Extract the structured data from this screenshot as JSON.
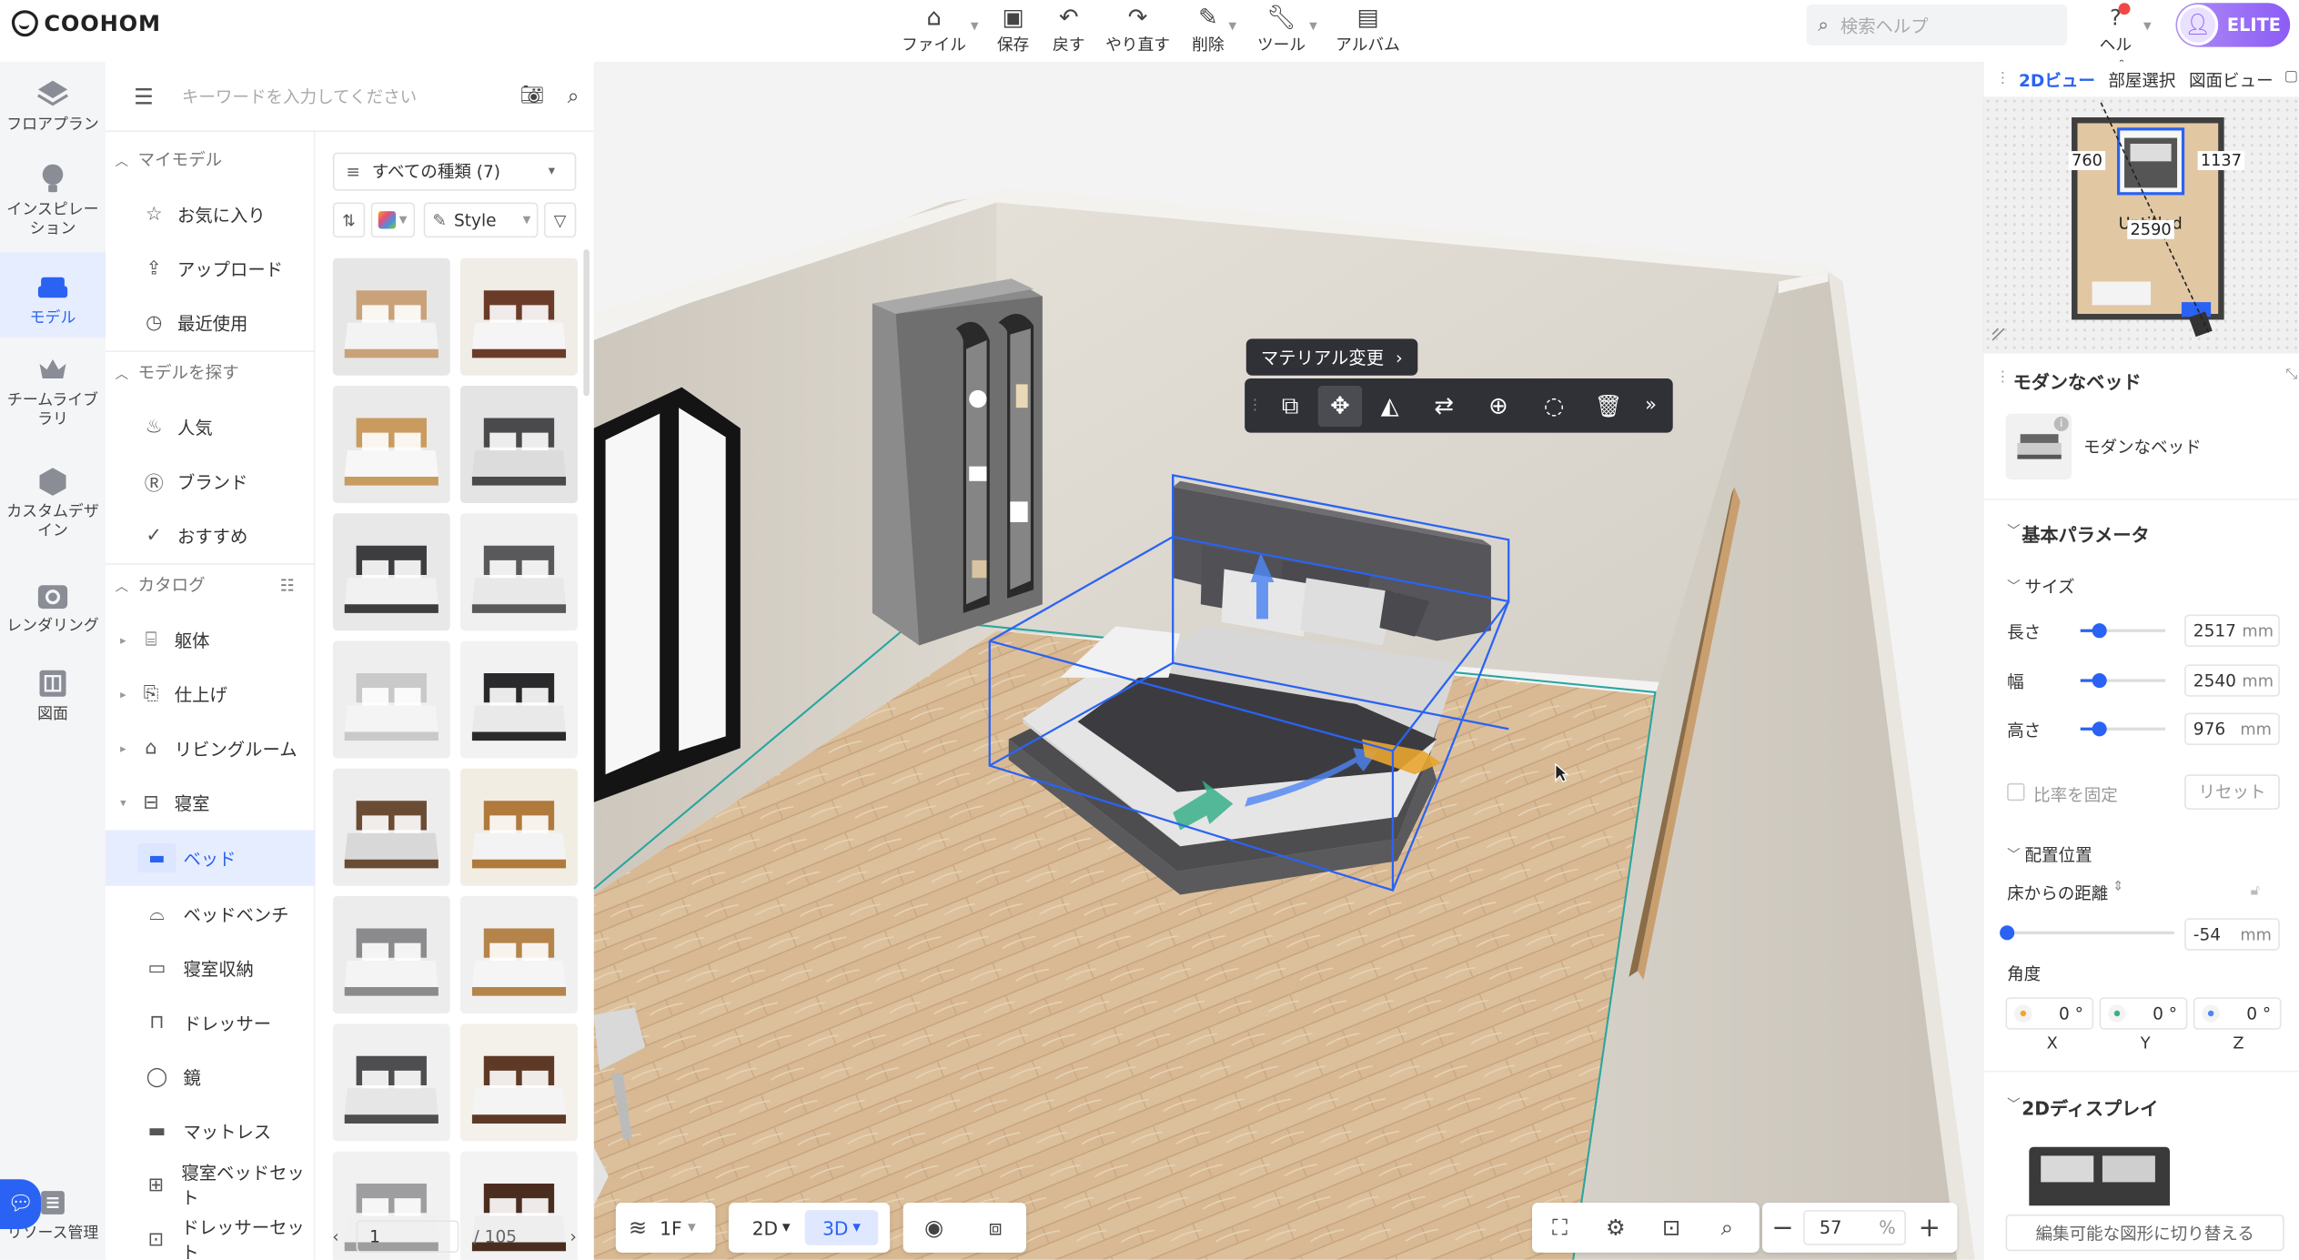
{
  "brand": {
    "name": "COOHOM",
    "accent": "#2a63f3",
    "elite": "#8b5cf6"
  },
  "toolbar": {
    "file": "ファイル",
    "save": "保存",
    "undo": "戻す",
    "redo": "やり直す",
    "delete": "削除",
    "tools": "ツール",
    "album": "アルバム",
    "search_placeholder": "検索ヘルプ",
    "help": "ヘルプ",
    "elite": "ELITE"
  },
  "leftnav": [
    {
      "label": "フロアプラン",
      "icon": "floorplan-icon"
    },
    {
      "label": "インスピレーション",
      "icon": "lightbulb-icon"
    },
    {
      "label": "モデル",
      "icon": "sofa-icon",
      "active": true
    },
    {
      "label": "チームライブラリ",
      "icon": "crown-icon"
    },
    {
      "label": "カスタムデザイン",
      "icon": "custom-box-icon"
    },
    {
      "label": "レンダリング",
      "icon": "camera-icon"
    },
    {
      "label": "図面",
      "icon": "drawing-icon"
    },
    {
      "label": "リソース管理",
      "icon": "resource-icon"
    }
  ],
  "catalog": {
    "search_placeholder": "キーワードを入力してください",
    "my_models_header": "マイモデル",
    "favorites": "お気に入り",
    "upload": "アップロード",
    "recent": "最近使用",
    "find_header": "モデルを探す",
    "popular": "人気",
    "brand": "ブランド",
    "recommended": "おすすめ",
    "catalog_header": "カタログ",
    "items": [
      "躯体",
      "仕上げ",
      "リビングルーム",
      "寝室"
    ],
    "bedroom_items": [
      "ベッド",
      "ベッドベンチ",
      "寝室収納",
      "ドレッサー",
      "鏡",
      "マットレス",
      "寝室ベッドセット",
      "ドレッサーセット"
    ]
  },
  "models": {
    "filter_label": "すべての種類 (7)",
    "style_label": "Style",
    "page": "1",
    "total_pages": "/ 105"
  },
  "viewport": {
    "material_change": "マテリアル変更",
    "floor_label": "1F",
    "view2d": "2D",
    "view3d": "3D",
    "zoom": "57",
    "zoom_unit": "%"
  },
  "rightpanel": {
    "tab_2d": "2Dビュー",
    "tab_room": "部屋選択",
    "tab_drawing": "図面ビュー",
    "dim_760": "760",
    "dim_1137": "1137",
    "dim_2590": "2590",
    "room_label": "Untitled",
    "title": "モダンなベッド",
    "item_name": "モダンなベッド",
    "basic_params": "基本パラメータ",
    "size": "サイズ",
    "length_label": "長さ",
    "length": "2517",
    "width_label": "幅",
    "width": "2540",
    "height_label": "高さ",
    "height": "976",
    "unit_mm": "mm",
    "lock_ratio": "比率を固定",
    "reset": "リセット",
    "placement": "配置位置",
    "floor_distance": "床からの距離",
    "floor_distance_value": "-54",
    "angle": "角度",
    "angle_x": "0 °",
    "angle_y": "0 °",
    "angle_z": "0 °",
    "axis_x": "X",
    "axis_y": "Y",
    "axis_z": "Z",
    "display2d": "2Dディスプレイ",
    "switch_shape": "編集可能な図形に切り替える"
  }
}
